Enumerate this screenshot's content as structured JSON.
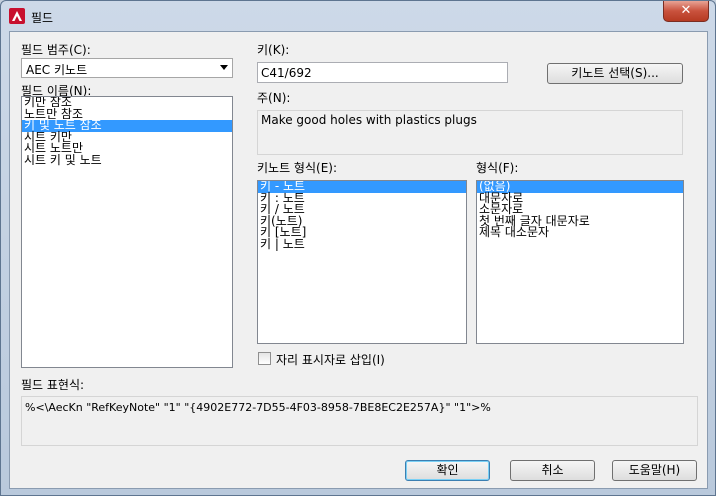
{
  "window": {
    "title": "필드",
    "close_label": "✕"
  },
  "category": {
    "label": "필드 범주(C):",
    "value": "AEC 키노트"
  },
  "field_names": {
    "label": "필드 이름(N):",
    "items": [
      "키만 참조",
      "노트만 참조",
      "키 및 노트 참조",
      "시트 키만",
      "시트 노트만",
      "시트 키 및 노트"
    ],
    "selected_index": 2
  },
  "key": {
    "label": "키(K):",
    "value": "C41/692"
  },
  "keynote_select_button": "키노트 선택(S)...",
  "note": {
    "label": "주(N):",
    "value": "Make good holes with plastics plugs"
  },
  "keynote_format": {
    "label": "키노트 형식(E):",
    "items": [
      "키 - 노트",
      "키 : 노트",
      "키 / 노트",
      "키(노트)",
      "키 [노트]",
      "키 | 노트"
    ],
    "selected_index": 0
  },
  "format": {
    "label": "형식(F):",
    "items": [
      "(없음)",
      "대문자로",
      "소문자로",
      "첫 번째 글자 대문자로",
      "제목 대소문자"
    ],
    "selected_index": 0
  },
  "placeholder_checkbox": {
    "label": "자리 표시자로 삽입(I)",
    "checked": false
  },
  "expression": {
    "label": "필드 표현식:",
    "value": "%<\\AecKn \"RefKeyNote\" \"1\" \"{4902E772-7D55-4F03-8958-7BE8EC2E257A}\" \"1\">%"
  },
  "buttons": {
    "ok": "확인",
    "cancel": "취소",
    "help": "도움말(H)"
  },
  "colors": {
    "selection": "#3399ff",
    "close": "#c9523d"
  }
}
